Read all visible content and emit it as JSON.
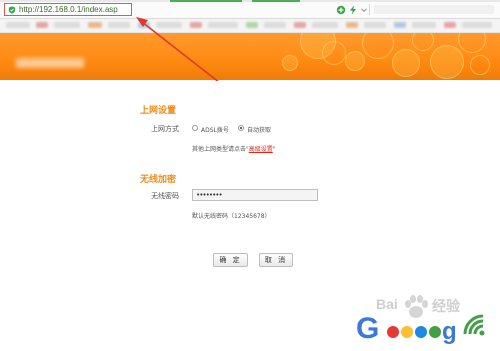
{
  "browser": {
    "url": "http://192.168.0.1/index.asp",
    "icons": [
      "shield-icon",
      "add-icon",
      "lightning-icon",
      "dropdown-icon"
    ]
  },
  "colors": {
    "accent": "#f08c18",
    "banner": "#ff8a12",
    "link": "#e0261c",
    "highlight": "#e05a4a"
  },
  "section_internet": {
    "title": "上网设置",
    "mode_label": "上网方式",
    "options": [
      {
        "label": "ADSL拨号",
        "checked": false
      },
      {
        "label": "自动获取",
        "checked": true
      }
    ],
    "hint_prefix": "其他上网类型请点击\"",
    "hint_link": "高级设置",
    "hint_suffix": "\""
  },
  "section_wireless": {
    "title": "无线加密",
    "password_label": "无线密码",
    "password_value": "••••••••",
    "default_hint": "默认无线密码（12345678）"
  },
  "buttons": {
    "ok": "确 定",
    "cancel": "取 消"
  },
  "watermark": {
    "brand_left": "Bai",
    "brand_right": "经验",
    "letter_g1": "G",
    "letter_g2": "g"
  }
}
